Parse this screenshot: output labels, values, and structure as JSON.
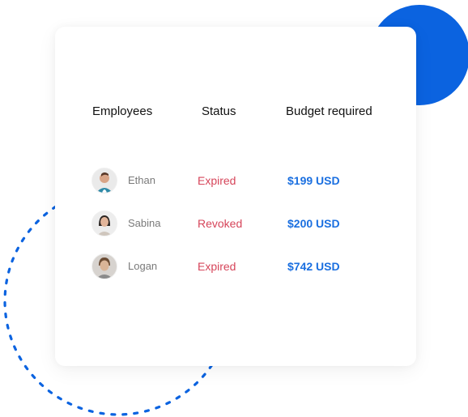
{
  "colors": {
    "accent_blue": "#0b63e0",
    "status_red": "#d6455a",
    "budget_blue": "#1a6fe0",
    "name_gray": "#7a7a7a"
  },
  "table": {
    "headers": {
      "employees": "Employees",
      "status": "Status",
      "budget": "Budget required"
    },
    "rows": [
      {
        "name": "Ethan",
        "status": "Expired",
        "budget": "$199 USD",
        "avatar": "avatar-man-smiling"
      },
      {
        "name": "Sabina",
        "status": "Revoked",
        "budget": "$200 USD",
        "avatar": "avatar-woman"
      },
      {
        "name": "Logan",
        "status": "Expired",
        "budget": "$742 USD",
        "avatar": "avatar-man"
      }
    ]
  }
}
